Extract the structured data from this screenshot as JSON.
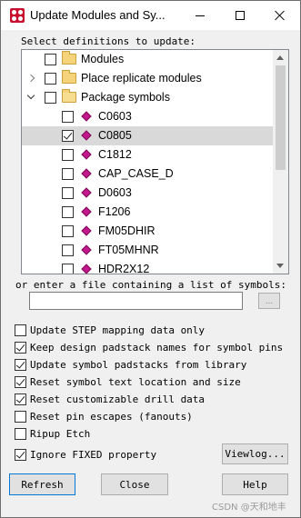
{
  "window": {
    "title": "Update Modules and Sy..."
  },
  "select_label": "Select definitions to update:",
  "tree": {
    "items": [
      {
        "label": "Modules",
        "level": 1,
        "expander": "none",
        "checked": false,
        "icon": "folder-icon"
      },
      {
        "label": "Place replicate modules",
        "level": 1,
        "expander": "collapsed",
        "checked": false,
        "icon": "folder-icon"
      },
      {
        "label": "Package symbols",
        "level": 1,
        "expander": "expanded",
        "checked": false,
        "icon": "folder-open-icon"
      },
      {
        "label": "C0603",
        "level": 2,
        "checked": false,
        "icon": "symbol-icon"
      },
      {
        "label": "C0805",
        "level": 2,
        "checked": true,
        "selected": true,
        "icon": "symbol-icon"
      },
      {
        "label": "C1812",
        "level": 2,
        "checked": false,
        "icon": "symbol-icon"
      },
      {
        "label": "CAP_CASE_D",
        "level": 2,
        "checked": false,
        "icon": "symbol-icon"
      },
      {
        "label": "D0603",
        "level": 2,
        "checked": false,
        "icon": "symbol-icon"
      },
      {
        "label": "F1206",
        "level": 2,
        "checked": false,
        "icon": "symbol-icon"
      },
      {
        "label": "FM05DHIR",
        "level": 2,
        "checked": false,
        "icon": "symbol-icon"
      },
      {
        "label": "FT05MHNR",
        "level": 2,
        "checked": false,
        "icon": "symbol-icon"
      },
      {
        "label": "HDR2X12",
        "level": 2,
        "checked": false,
        "icon": "symbol-icon"
      }
    ]
  },
  "file_label": "or enter a file containing a list of symbols:",
  "file_input": {
    "value": "",
    "placeholder": ""
  },
  "browse_label": "...",
  "options": [
    {
      "label": "Update STEP mapping data only",
      "checked": false
    },
    {
      "label": "Keep design padstack names for symbol pins",
      "checked": true
    },
    {
      "label": "Update symbol padstacks from library",
      "checked": true
    },
    {
      "label": "Reset symbol text location and size",
      "checked": true
    },
    {
      "label": "Reset customizable drill data",
      "checked": true
    },
    {
      "label": "Reset pin escapes (fanouts)",
      "checked": false
    },
    {
      "label": "Ripup Etch",
      "checked": false
    },
    {
      "label": "Ignore FIXED property",
      "checked": true
    }
  ],
  "viewlog_label": "Viewlog...",
  "buttons": {
    "refresh": "Refresh",
    "close": "Close",
    "help": "Help"
  },
  "watermark": "CSDN @天和地丰",
  "colors": {
    "selection": "#d9d9d9",
    "symbol": "#c2188c",
    "app_icon": "#c8102e"
  }
}
